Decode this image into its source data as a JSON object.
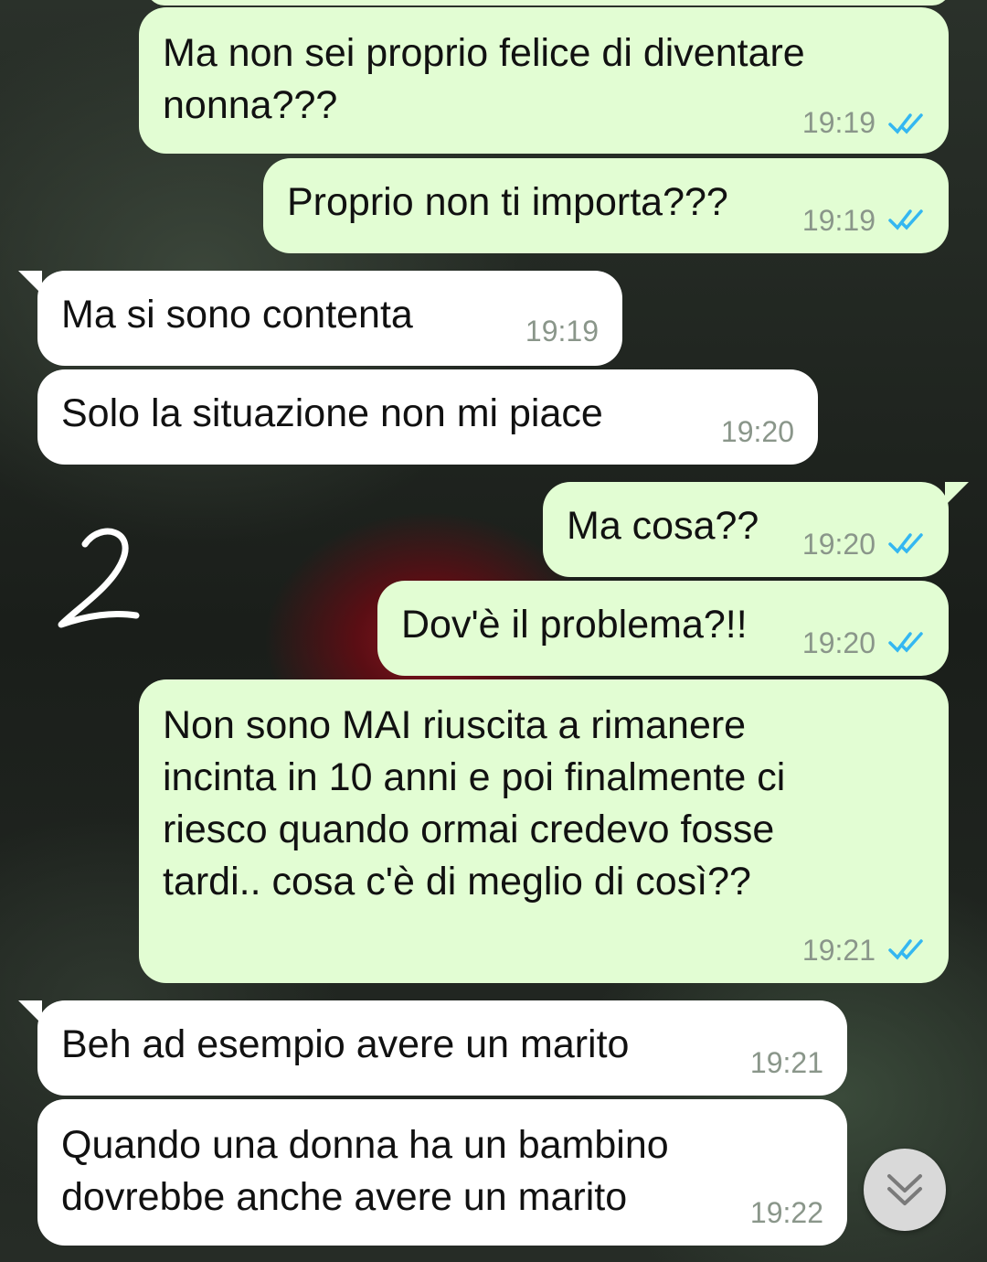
{
  "colors": {
    "outgoing_bubble": "#e2fdd3",
    "incoming_bubble": "#ffffff",
    "read_ticks": "#34b7f1",
    "timestamp": "#8a968a"
  },
  "messages": [
    {
      "direction": "out",
      "text": "Ma non sei proprio felice di diventare\nnonna???",
      "time": "19:19",
      "status": "read"
    },
    {
      "direction": "out",
      "text": "Proprio non ti importa???",
      "time": "19:19",
      "status": "read"
    },
    {
      "direction": "in",
      "text": "Ma si sono contenta",
      "time": "19:19"
    },
    {
      "direction": "in",
      "text": "Solo la situazione non mi piace",
      "time": "19:20"
    },
    {
      "direction": "out",
      "text": "Ma cosa??",
      "time": "19:20",
      "status": "read"
    },
    {
      "direction": "out",
      "text": "Dov'è il problema?!!",
      "time": "19:20",
      "status": "read"
    },
    {
      "direction": "out",
      "text": "Non sono MAI riuscita a rimanere\nincinta in 10 anni e poi finalmente ci\nriesco quando ormai credevo fosse\ntardi.. cosa c'è di meglio di così??",
      "time": "19:21",
      "status": "read"
    },
    {
      "direction": "in",
      "text": "Beh ad esempio avere un marito",
      "time": "19:21"
    },
    {
      "direction": "in",
      "text": "Quando una donna ha un bambino\ndovrebbe anche avere un marito",
      "time": "19:22"
    }
  ],
  "annotation": "2",
  "scroll_button": {
    "icon": "double-chevron-down-icon"
  }
}
